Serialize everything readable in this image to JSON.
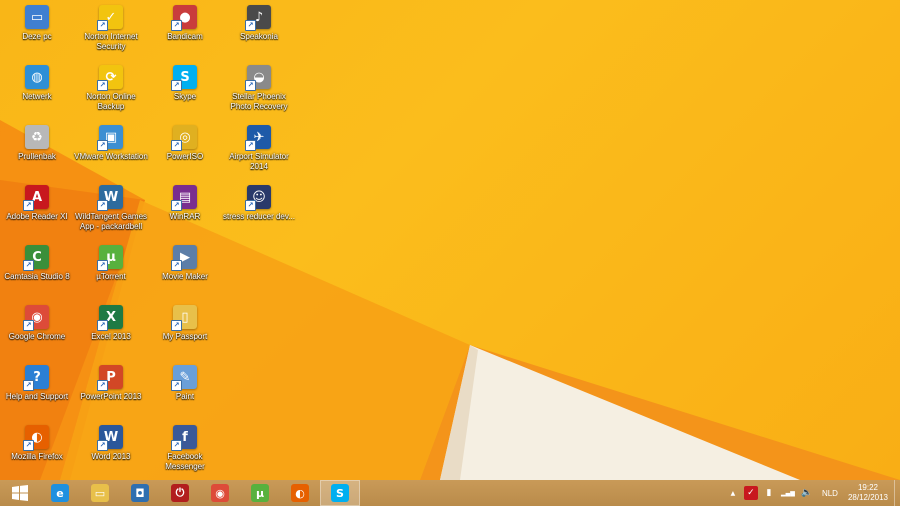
{
  "desktop": {
    "columns": [
      [
        {
          "label": "Deze pc",
          "icon": "computer-icon",
          "color": "#3f7fd0",
          "glyph": "▭",
          "shortcut": false
        },
        {
          "label": "Netwerk",
          "icon": "network-icon",
          "color": "#2e8fd6",
          "glyph": "◍",
          "shortcut": false
        },
        {
          "label": "Prullenbak",
          "icon": "recycle-bin-icon",
          "color": "#b8b8b8",
          "glyph": "♻",
          "shortcut": false
        },
        {
          "label": "Adobe Reader XI",
          "icon": "adobe-reader-icon",
          "color": "#c8181e",
          "glyph": "A",
          "shortcut": true
        },
        {
          "label": "Camtasia Studio 8",
          "icon": "camtasia-icon",
          "color": "#3a8f3a",
          "glyph": "C",
          "shortcut": true
        },
        {
          "label": "Google Chrome",
          "icon": "chrome-icon",
          "color": "#dd4b39",
          "glyph": "◉",
          "shortcut": true
        },
        {
          "label": "Help and Support",
          "icon": "help-icon",
          "color": "#2a7fd4",
          "glyph": "?",
          "shortcut": true
        },
        {
          "label": "Mozilla Firefox",
          "icon": "firefox-icon",
          "color": "#e66000",
          "glyph": "◐",
          "shortcut": true
        }
      ],
      [
        {
          "label": "Norton Internet Security",
          "icon": "norton-icon",
          "color": "#f2c40f",
          "glyph": "✓",
          "shortcut": true
        },
        {
          "label": "Norton Online Backup",
          "icon": "norton-backup-icon",
          "color": "#f2c40f",
          "glyph": "⟳",
          "shortcut": true
        },
        {
          "label": "VMware Workstation",
          "icon": "vmware-icon",
          "color": "#3c8fd2",
          "glyph": "▣",
          "shortcut": true
        },
        {
          "label": "WildTangent Games App - packardbell",
          "icon": "wildtangent-icon",
          "color": "#2d6b9e",
          "glyph": "W",
          "shortcut": true
        },
        {
          "label": "µTorrent",
          "icon": "utorrent-icon",
          "color": "#58b13e",
          "glyph": "µ",
          "shortcut": true
        },
        {
          "label": "Excel 2013",
          "icon": "excel-icon",
          "color": "#1f7a44",
          "glyph": "X",
          "shortcut": true
        },
        {
          "label": "PowerPoint 2013",
          "icon": "powerpoint-icon",
          "color": "#d24726",
          "glyph": "P",
          "shortcut": true
        },
        {
          "label": "Word 2013",
          "icon": "word-icon",
          "color": "#2b579a",
          "glyph": "W",
          "shortcut": true
        }
      ],
      [
        {
          "label": "Bandicam",
          "icon": "bandicam-icon",
          "color": "#c93c3c",
          "glyph": "●",
          "shortcut": true
        },
        {
          "label": "Skype",
          "icon": "skype-icon",
          "color": "#00aff0",
          "glyph": "S",
          "shortcut": true
        },
        {
          "label": "PowerISO",
          "icon": "poweriso-icon",
          "color": "#e0b020",
          "glyph": "◎",
          "shortcut": true
        },
        {
          "label": "WinRAR",
          "icon": "winrar-icon",
          "color": "#7a2d8f",
          "glyph": "▤",
          "shortcut": true
        },
        {
          "label": "Movie Maker",
          "icon": "movie-maker-icon",
          "color": "#5c7ea8",
          "glyph": "▶",
          "shortcut": true
        },
        {
          "label": "My Passport",
          "icon": "folder-icon",
          "color": "#e8c04a",
          "glyph": "▯",
          "shortcut": true
        },
        {
          "label": "Paint",
          "icon": "paint-icon",
          "color": "#6a9fd8",
          "glyph": "✎",
          "shortcut": true
        },
        {
          "label": "Facebook Messenger",
          "icon": "messenger-icon",
          "color": "#3b5998",
          "glyph": "f",
          "shortcut": true
        }
      ],
      [
        {
          "label": "Speakonia",
          "icon": "speakonia-icon",
          "color": "#4a4a4a",
          "glyph": "♪",
          "shortcut": true
        },
        {
          "label": "Stellar Phoenix Photo Recovery",
          "icon": "stellar-icon",
          "color": "#8a8a8a",
          "glyph": "◒",
          "shortcut": true
        },
        {
          "label": "Airport Simulator 2014",
          "icon": "airport-sim-icon",
          "color": "#1e5aa8",
          "glyph": "✈",
          "shortcut": true
        },
        {
          "label": "stress reducer dev...",
          "icon": "stress-reducer-icon",
          "color": "#2a3a6a",
          "glyph": "☺",
          "shortcut": true
        }
      ]
    ]
  },
  "taskbar": {
    "start": {
      "icon": "windows-start-icon"
    },
    "pinned": [
      {
        "name": "internet-explorer",
        "icon": "internet-explorer-icon",
        "color": "#1e90e0",
        "glyph": "e",
        "active": false
      },
      {
        "name": "file-explorer",
        "icon": "file-explorer-icon",
        "color": "#e8c04a",
        "glyph": "▭",
        "active": false
      },
      {
        "name": "app-3",
        "icon": "app-tile-icon",
        "color": "#2e6fb0",
        "glyph": "◘",
        "active": false
      },
      {
        "name": "power-app",
        "icon": "power-icon",
        "color": "#b21e1e",
        "glyph": "⏻",
        "active": false
      },
      {
        "name": "chrome",
        "icon": "chrome-icon",
        "color": "#dd4b39",
        "glyph": "◉",
        "active": false
      },
      {
        "name": "utorrent",
        "icon": "utorrent-icon",
        "color": "#58b13e",
        "glyph": "µ",
        "active": false
      },
      {
        "name": "firefox",
        "icon": "firefox-icon",
        "color": "#e66000",
        "glyph": "◐",
        "active": false
      },
      {
        "name": "skype",
        "icon": "skype-icon",
        "color": "#00aff0",
        "glyph": "S",
        "active": true
      }
    ],
    "tray": {
      "icons": [
        "chevron-up-icon",
        "norton-tray-icon",
        "battery-icon",
        "network-signal-icon",
        "volume-icon"
      ],
      "language": "NLD",
      "time": "19:22",
      "date": "28/12/2013"
    }
  }
}
